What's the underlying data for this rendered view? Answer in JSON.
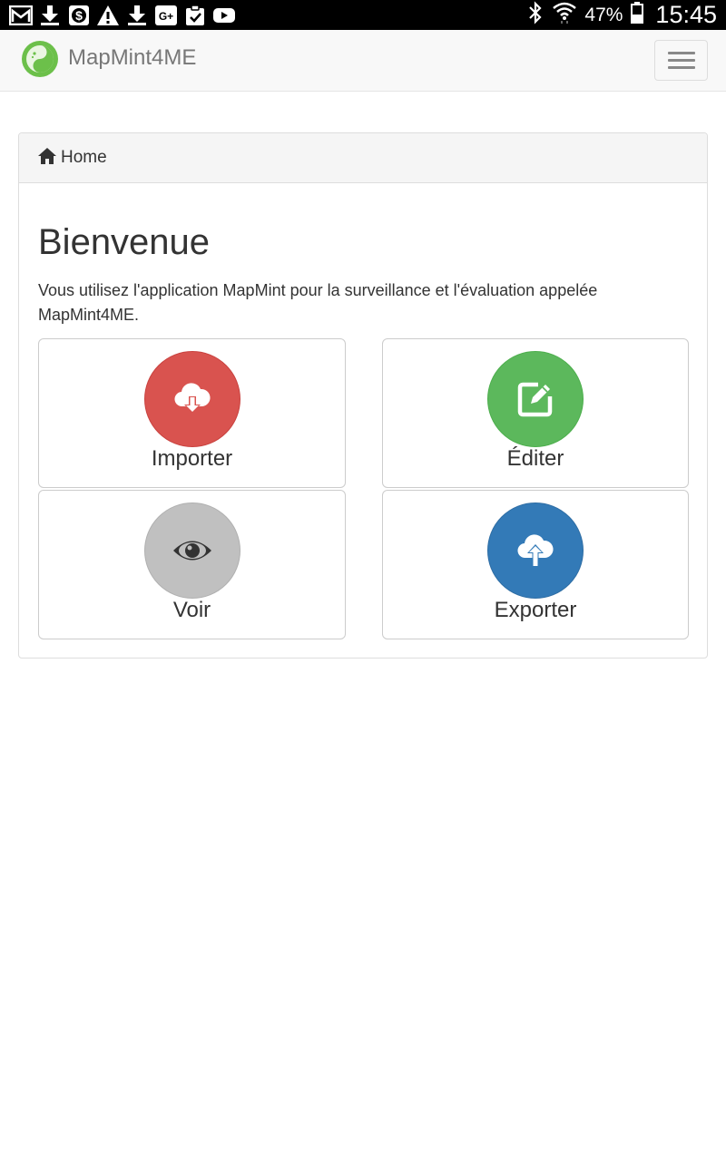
{
  "status_bar": {
    "notification_icons": [
      "gmail-icon",
      "download-icon",
      "dollar-icon",
      "warning-icon",
      "download-icon",
      "google-plus-icon",
      "clipboard-check-icon",
      "youtube-icon"
    ],
    "battery_percent": "47%",
    "time": "15:45"
  },
  "navbar": {
    "brand_title": "MapMint4ME",
    "brand_color": "#6cc04a"
  },
  "breadcrumb": {
    "home_label": "Home"
  },
  "welcome": {
    "title": "Bienvenue",
    "text": "Vous utilisez l'application MapMint pour la surveillance et l'évaluation appelée MapMint4ME."
  },
  "tiles": [
    {
      "label": "Importer",
      "icon": "cloud-download-icon",
      "color": "#d9534f"
    },
    {
      "label": "Éditer",
      "icon": "edit-icon",
      "color": "#5cb85c"
    },
    {
      "label": "Voir",
      "icon": "eye-icon",
      "color": "#c0c0c0"
    },
    {
      "label": "Exporter",
      "icon": "cloud-upload-icon",
      "color": "#337ab7"
    }
  ]
}
